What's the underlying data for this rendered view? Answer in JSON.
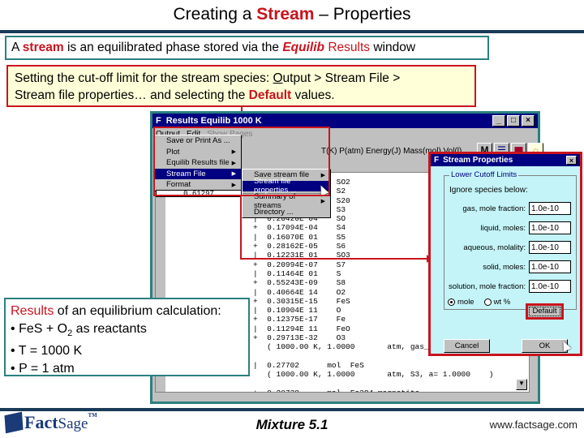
{
  "slide": {
    "title_pre": "Creating a ",
    "title_emph": "Stream",
    "title_post": " – Properties"
  },
  "intro": {
    "part1": "A ",
    "emph1": "stream",
    "part2": " is an equilibrated phase stored via the ",
    "emph2": "Equilib",
    "emph3": " Results",
    "part3": " window"
  },
  "note": {
    "line1_pre": "Setting the cut-off limit for the stream species:  ",
    "menu_key": "O",
    "line1_post": "utput > Stream File >",
    "line2_pre": "Stream file properties… and selecting the ",
    "emph": "Default",
    "line2_post": " values."
  },
  "results_window": {
    "title": "Results   Equilib   1000 K",
    "app_icon": "F",
    "controls": [
      "_",
      "□",
      "×"
    ],
    "menubar": [
      {
        "label": "Output",
        "state": "active"
      },
      {
        "label": "Edit",
        "state": "normal"
      },
      {
        "label": "Show Pages",
        "state": "disabled"
      }
    ],
    "column_header": "T(K)  P(atm)  Energy(J)  Mass(mol)  Vol(l)",
    "toolbar_icons": [
      {
        "name": "m-icon",
        "glyph": "M"
      },
      {
        "name": "list-icon",
        "glyph": "☰"
      },
      {
        "name": "page-icon",
        "glyph": "▆"
      },
      {
        "name": "bulb-icon",
        "glyph": "☼"
      }
    ],
    "partial_row": "0.61297",
    "result_lines": [
      "                  SO2",
      "                  S2",
      "                  S20",
      "+  0.39935E-02    S3",
      "|  0.20420E 04    SO",
      "+  0.17094E-04    S4",
      "|  0.16070E 01    S5",
      "+  0.28162E-05    S6",
      "|  0.12231E 01    SO3",
      "+  0.20994E-07    S7",
      "|  0.11464E 01    S",
      "+  0.55243E-09    S8",
      "|  0.40664E 14    O2",
      "+  0.30315E-15    FeS",
      "|  0.10904E 11    O",
      "+  0.12375E-17    Fe",
      "|  0.11294E 11    FeO",
      "+  0.29713E-32    O3",
      "   ( 1000.00 K, 1.0000       atm, gas_ideal",
      "",
      "|  0.27702      mol  FeS",
      "   ( 1000.00 K, 1.0000       atm, S3, a= 1.0000    )",
      "",
      "+  0.20738      mol  Fe3O4 magnetite"
    ]
  },
  "output_menu": {
    "items": [
      {
        "label": "Save or Print As ...",
        "has_sub": false,
        "selected": false
      },
      {
        "label": "Plot",
        "has_sub": true,
        "selected": false
      },
      {
        "label": "Equilib Results file",
        "has_sub": true,
        "selected": false
      },
      {
        "label": "Stream File",
        "has_sub": true,
        "selected": true
      },
      {
        "label": "Format",
        "has_sub": true,
        "selected": false
      }
    ]
  },
  "stream_file_menu": {
    "items": [
      {
        "label": "Save stream file",
        "has_sub": true,
        "selected": false
      },
      {
        "label": "Stream file properties ...",
        "has_sub": false,
        "selected": true
      },
      {
        "label": "Summary of streams",
        "has_sub": true,
        "selected": false
      },
      {
        "label": "Directory ...",
        "has_sub": false,
        "selected": false
      }
    ]
  },
  "stream_properties_dialog": {
    "title": "Stream Properties",
    "app_icon": "F",
    "close": "×",
    "group_label": "Lower Cutoff Limits",
    "ignore_label": "Ignore species below:",
    "fields": [
      {
        "label": "gas, mole fraction:",
        "value": "1.0e-10"
      },
      {
        "label": "liquid, moles:",
        "value": "1.0e-10"
      },
      {
        "label": "aqueous, molality:",
        "value": "1.0e-10"
      },
      {
        "label": "solid, moles:",
        "value": "1.0e-10"
      },
      {
        "label": "solution, mole fraction:",
        "value": "1.0e-10"
      }
    ],
    "units": [
      {
        "label": "mole",
        "checked": true
      },
      {
        "label": "wt %",
        "checked": false
      }
    ],
    "default_button": "Default",
    "cancel_button": "Cancel",
    "ok_button": "OK"
  },
  "info": {
    "heading_emph": "Results",
    "heading_rest": " of an equilibrium calculation:",
    "bullets": [
      {
        "pre": "FeS + O",
        "sub": "2",
        "post": " as reactants"
      },
      {
        "pre": "T = 1000 K",
        "sub": "",
        "post": ""
      },
      {
        "pre": "P = 1 atm",
        "sub": "",
        "post": ""
      }
    ],
    "bullet_glyph": "•"
  },
  "footer": {
    "logo_fact": "Fact",
    "logo_sage": "Sage",
    "logo_tm": "TM",
    "center": "Mixture  5.1",
    "url": "www.factsage.com"
  },
  "colors": {
    "accent_red": "#c8141e",
    "teal_border": "#2b8080",
    "navy_rule": "#1a3a58",
    "dialog_bg": "#c4f4f8",
    "note_bg": "#ffffd8",
    "titlebar": "#000080"
  }
}
